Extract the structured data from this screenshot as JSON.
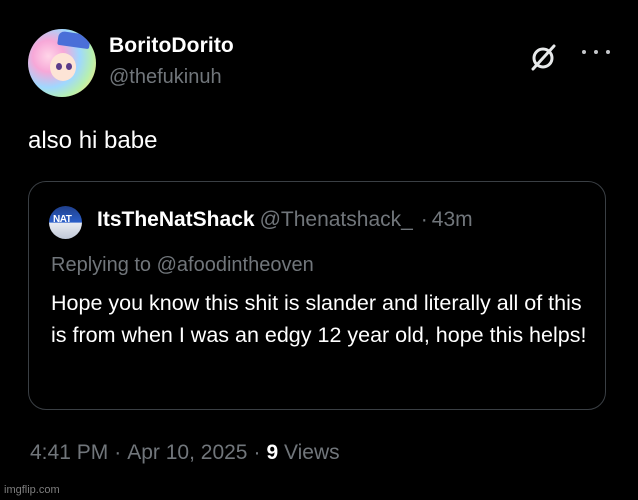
{
  "author": {
    "display_name": "BoritoDorito",
    "handle": "@thefukinuh"
  },
  "tweet": {
    "text": "also hi babe"
  },
  "quoted": {
    "avatar_text": "NAT",
    "display_name": "ItsTheNatShack",
    "handle": "@Thenatshack_",
    "separator": "·",
    "time": "43m",
    "replying_prefix": "Replying to",
    "replying_to": "@afoodintheoven",
    "text": "Hope you know this shit is slander and literally all of this is from when I was an edgy 12 year old, hope this helps!"
  },
  "meta": {
    "time": "4:41 PM",
    "separator": "·",
    "date": "Apr 10, 2025",
    "views_count": "9",
    "views_label": "Views"
  },
  "watermark": "imgflip.com",
  "icons": {
    "grok": "grok-icon",
    "more": "more-icon"
  },
  "colors": {
    "background": "#000000",
    "primary_text": "#ffffff",
    "secondary_text": "#71767b",
    "border": "#3a3f44"
  }
}
